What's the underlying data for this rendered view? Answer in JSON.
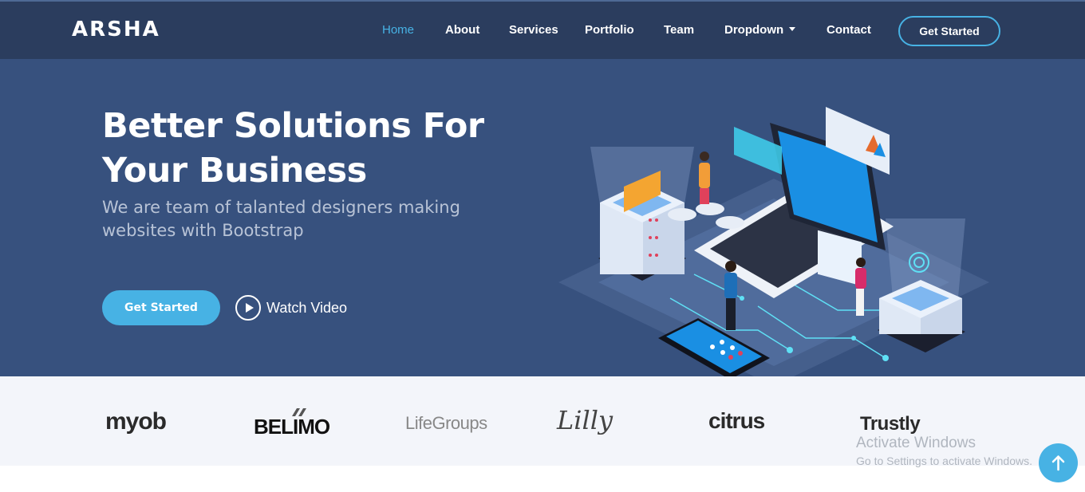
{
  "header": {
    "logo": "ARSHA",
    "nav": [
      {
        "label": "Home",
        "active": true
      },
      {
        "label": "About"
      },
      {
        "label": "Services"
      },
      {
        "label": "Portfolio"
      },
      {
        "label": "Team"
      },
      {
        "label": "Dropdown",
        "has_caret": true
      },
      {
        "label": "Contact"
      }
    ],
    "cta_label": "Get Started"
  },
  "hero": {
    "title_line1": "Better Solutions For",
    "title_line2": "Your Business",
    "subtitle_line1": "We are team of talanted designers making",
    "subtitle_line2": "websites with Bootstrap",
    "primary_button": "Get Started",
    "watch_video": "Watch Video",
    "illustration": "isometric-laptop-servers-people-illustration"
  },
  "clients": {
    "logos": [
      "myob",
      "BELIMO",
      "LifeGroups",
      "Lilly",
      "citrus",
      "Trustly"
    ]
  },
  "watermark": {
    "title": "Activate Windows",
    "subtitle": "Go to Settings to activate Windows."
  },
  "colors": {
    "header_bg": "#2b3d5e",
    "hero_bg": "#37517e",
    "accent": "#47b2e4",
    "clients_bg": "#f3f5fa"
  },
  "icons": {
    "play": "play-circle-icon",
    "back_to_top": "arrow-up-icon",
    "dropdown": "caret-down-icon"
  }
}
